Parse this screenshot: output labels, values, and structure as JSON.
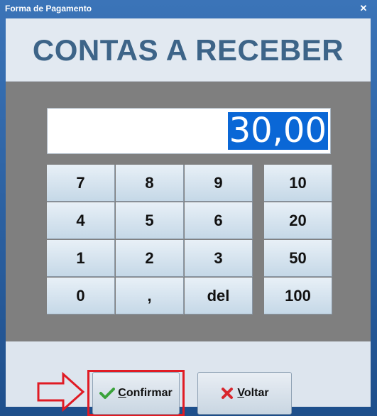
{
  "window": {
    "title": "Forma de Pagamento",
    "close_symbol": "✕"
  },
  "header": {
    "title": "CONTAS A RECEBER"
  },
  "display": {
    "value": "30,00"
  },
  "keypad": {
    "digits": [
      "7",
      "8",
      "9",
      "4",
      "5",
      "6",
      "1",
      "2",
      "3",
      "0",
      ",",
      "del"
    ],
    "amounts": [
      "10",
      "20",
      "50",
      "100"
    ]
  },
  "actions": {
    "confirm_label": "Confirmar",
    "back_label": "Voltar"
  },
  "colors": {
    "accent_red": "#e01b24",
    "selection_blue": "#0a67d6",
    "check_green": "#3aa33a"
  }
}
